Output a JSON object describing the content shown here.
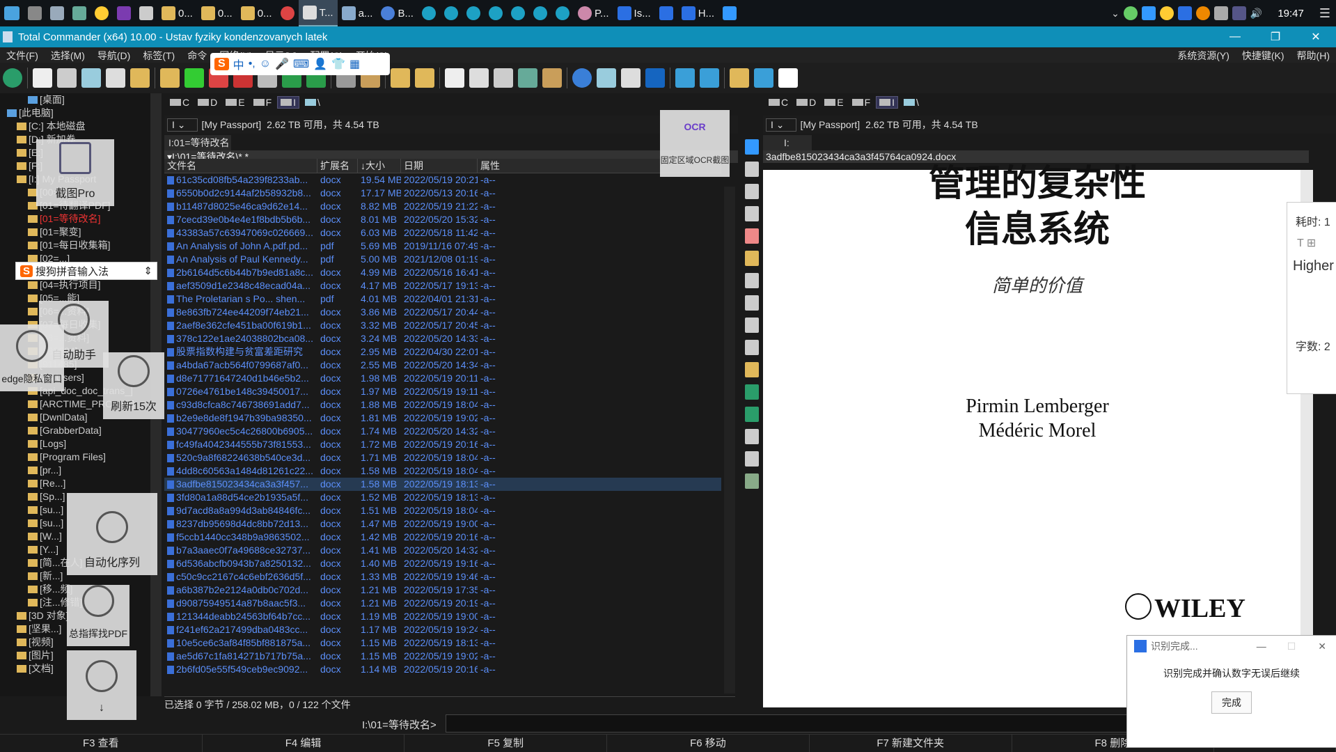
{
  "taskbar": {
    "buttons": [
      {
        "label": "0..."
      },
      {
        "label": "0..."
      },
      {
        "label": "0..."
      },
      {
        "label": "T..."
      },
      {
        "label": "a..."
      },
      {
        "label": "B..."
      },
      {
        "label": "P..."
      },
      {
        "label": "Is..."
      },
      {
        "label": "H..."
      }
    ],
    "time": "19:47"
  },
  "window": {
    "title": "Total Commander (x64) 10.00 - Ustav fyziky kondenzovanych latek"
  },
  "menu": {
    "left": [
      "文件(F)",
      "选择(M)",
      "导航(D)",
      "标签(T)",
      "命令",
      "网络(N)",
      "显示(V)",
      "配置(C)",
      "开始(S)"
    ],
    "right": [
      "系统资源(Y)",
      "快捷键(K)",
      "帮助(H)"
    ]
  },
  "drives": [
    "C",
    "D",
    "E",
    "F",
    "I",
    "\\"
  ],
  "left_panel": {
    "volume": "[My Passport]",
    "free_info": "2.62 TB 可用，共 4.54 TB",
    "tab": "I:01=等待改名",
    "path": "I:\\01=等待改名\\*.*",
    "columns": [
      "文件名",
      "扩展名",
      "大小",
      "日期",
      "属性"
    ],
    "files": [
      [
        "61c35cd08fb54a239f8233ab...",
        "docx",
        "19.54 MB",
        "2022/05/19 20:21",
        "-a--"
      ],
      [
        "6550b0d2c9144af2b58932b8...",
        "docx",
        "17.17 MB",
        "2022/05/13 20:16",
        "-a--"
      ],
      [
        "b11487d8025e46ca9d62e14...",
        "docx",
        "8.82 MB",
        "2022/05/19 21:22",
        "-a--"
      ],
      [
        "7cecd39e0b4e4e1f8bdb5b6b...",
        "docx",
        "8.01 MB",
        "2022/05/20 15:32",
        "-a--"
      ],
      [
        "43383a57c63947069c026669...",
        "docx",
        "6.03 MB",
        "2022/05/18 11:42",
        "-a--"
      ],
      [
        "An Analysis of John A.pdf.pd...",
        "pdf",
        "5.69 MB",
        "2019/11/16 07:49",
        "-a--"
      ],
      [
        "An Analysis of Paul Kennedy...",
        "pdf",
        "5.00 MB",
        "2021/12/08 01:19",
        "-a--"
      ],
      [
        "2b6164d5c6b44b7b9ed81a8c...",
        "docx",
        "4.99 MB",
        "2022/05/16 16:41",
        "-a--"
      ],
      [
        "aef3509d1e2348c48ecad04a...",
        "docx",
        "4.17 MB",
        "2022/05/17 19:13",
        "-a--"
      ],
      [
        "The Proletarian s Po... shen...",
        "pdf",
        "4.01 MB",
        "2022/04/01 21:31",
        "-a--"
      ],
      [
        "8e863fb724ee44209f74eb21...",
        "docx",
        "3.86 MB",
        "2022/05/17 20:44",
        "-a--"
      ],
      [
        "2aef8e362cfe451ba00f619b1...",
        "docx",
        "3.32 MB",
        "2022/05/17 20:45",
        "-a--"
      ],
      [
        "378c122e1ae24038802bca08...",
        "docx",
        "3.24 MB",
        "2022/05/20 14:33",
        "-a--"
      ],
      [
        "股票指数构建与贫富差距研究",
        "docx",
        "2.95 MB",
        "2022/04/30 22:01",
        "-a--"
      ],
      [
        "a4bda67acb564f0799687af0...",
        "docx",
        "2.55 MB",
        "2022/05/20 14:34",
        "-a--"
      ],
      [
        "d8e71771647240d1b46e5b2...",
        "docx",
        "1.98 MB",
        "2022/05/19 20:11",
        "-a--"
      ],
      [
        "0726e4761be148c39450017...",
        "docx",
        "1.97 MB",
        "2022/05/19 19:11",
        "-a--"
      ],
      [
        "c93d8cfca8c746738691add7...",
        "docx",
        "1.88 MB",
        "2022/05/19 18:04",
        "-a--"
      ],
      [
        "b2e9e8de8f1947b39ba98350...",
        "docx",
        "1.81 MB",
        "2022/05/19 19:02",
        "-a--"
      ],
      [
        "30477960ec5c4c26800b6905...",
        "docx",
        "1.74 MB",
        "2022/05/20 14:32",
        "-a--"
      ],
      [
        "fc49fa4042344555b73f81553...",
        "docx",
        "1.72 MB",
        "2022/05/19 20:16",
        "-a--"
      ],
      [
        "520c9a8f68224638b540ce3d...",
        "docx",
        "1.71 MB",
        "2022/05/19 18:04",
        "-a--"
      ],
      [
        "4dd8c60563a1484d81261c22...",
        "docx",
        "1.58 MB",
        "2022/05/19 18:04",
        "-a--"
      ],
      [
        "3adfbe815023434ca3a3f457...",
        "docx",
        "1.58 MB",
        "2022/05/19 18:13",
        "-a--"
      ],
      [
        "3fd80a1a88d54ce2b1935a5f...",
        "docx",
        "1.52 MB",
        "2022/05/19 18:13",
        "-a--"
      ],
      [
        "9d7acd8a8a994d3ab84846fc...",
        "docx",
        "1.51 MB",
        "2022/05/19 18:04",
        "-a--"
      ],
      [
        "8237db95698d4dc8bb72d13...",
        "docx",
        "1.47 MB",
        "2022/05/19 19:00",
        "-a--"
      ],
      [
        "f5ccb1440cc348b9a9863502...",
        "docx",
        "1.42 MB",
        "2022/05/19 20:16",
        "-a--"
      ],
      [
        "b7a3aaec0f7a49688ce32737...",
        "docx",
        "1.41 MB",
        "2022/05/20 14:32",
        "-a--"
      ],
      [
        "6d536abcfb0943b7a8250132...",
        "docx",
        "1.40 MB",
        "2022/05/19 19:16",
        "-a--"
      ],
      [
        "c50c9cc2167c4c6ebf2636d5f...",
        "docx",
        "1.33 MB",
        "2022/05/19 19:46",
        "-a--"
      ],
      [
        "a6b387b2e2124a0db0c702d...",
        "docx",
        "1.21 MB",
        "2022/05/19 17:35",
        "-a--"
      ],
      [
        "d90875949514a87b8aac5f3...",
        "docx",
        "1.21 MB",
        "2022/05/19 20:19",
        "-a--"
      ],
      [
        "121344deabb24563bf64b7cc...",
        "docx",
        "1.19 MB",
        "2022/05/19 19:00",
        "-a--"
      ],
      [
        "f241ef62a217499dba0483cc...",
        "docx",
        "1.17 MB",
        "2022/05/19 19:24",
        "-a--"
      ],
      [
        "10e5ce6c3af84f85bf881875a...",
        "docx",
        "1.15 MB",
        "2022/05/19 18:13",
        "-a--"
      ],
      [
        "ae5d67c1fa814271b717b75a...",
        "docx",
        "1.15 MB",
        "2022/05/19 19:02",
        "-a--"
      ],
      [
        "2b6fd05e55f549ceb9ec9092...",
        "docx",
        "1.14 MB",
        "2022/05/19 20:16",
        "-a--"
      ]
    ],
    "selected_index": 23,
    "status": "已选择 0 字节 / 258.02 MB，0 / 122 个文件"
  },
  "right_panel": {
    "volume": "[My Passport]",
    "free_info": "2.62 TB 可用，共 4.54 TB",
    "tab": "I:",
    "path": "3adfbe815023434ca3a3f45764ca0924.docx"
  },
  "document": {
    "title1": "管理的复杂性",
    "title2": "信息系统",
    "subtitle": "简单的价值",
    "author1": "Pirmin Lemberger",
    "author2": "Médéric Morel",
    "logo": "WILEY"
  },
  "tree": {
    "items": [
      "[桌面]",
      "[此电脑]",
      "[C:] 本地磁盘",
      "[D:] 新加卷",
      "[E:]",
      "[F:]",
      "[I:] My Passport",
      "[00=...kb]",
      "[01=待翻译PDF]",
      "[01=等待改名]",
      "[01=聚变]",
      "[01=每日收集箱]",
      "[02=...]",
      "[03=等待事项]",
      "[04=执行项目]",
      "[05=...能]",
      "[06=...资料]",
      "[07=每日收集]",
      "[08=...资料]",
      "[089984]",
      "[911485]",
      "[All Users]",
      "[api_doc_doc_trans_]",
      "[ARCTIME_PRO_3.1]",
      "[DwnlData]",
      "[GrabberData]",
      "[Logs]",
      "[Program Files]",
      "[pr...]",
      "[Re...]",
      "[Sp...]",
      "[su...]",
      "[su...]",
      "[W...]",
      "[Y...]",
      "[简...在人]",
      "[新...]",
      "[移...频]",
      "[注...修错]",
      "[3D 对象]",
      "[坚果...]",
      "[视频]",
      "[图片]",
      "[文档]"
    ],
    "selected_index": 9
  },
  "overlays": {
    "screenshot_pro": "截图Pro",
    "auto_helper": "自动助手",
    "edge_private": "edge隐私窗口",
    "refresh": "刷新15次",
    "auto_sequence": "自动化序列",
    "pdf_tool": "总指挥找PDF",
    "down": "↓",
    "ime_name": "搜狗拼音输入法",
    "ocr_label": "OCR",
    "ocr_caption": "固定区域OCR截图"
  },
  "popup": {
    "title": "识别完成...",
    "message": "识别完成并确认数字无误后继续",
    "button": "完成"
  },
  "side_panel": {
    "elapsed": "耗时: 1",
    "text": "Higher",
    "count": "字数: 2"
  },
  "command_line": {
    "prompt": "I:\\01=等待改名>"
  },
  "fkeys": [
    "F3 查看",
    "F4 编辑",
    "F5 复制",
    "F6 移动",
    "F7 新建文件夹",
    "F8 删除"
  ],
  "colors": {
    "accent": "#0f8fb8",
    "file_text": "#5b8ff9",
    "selected_row": "#263a52"
  }
}
